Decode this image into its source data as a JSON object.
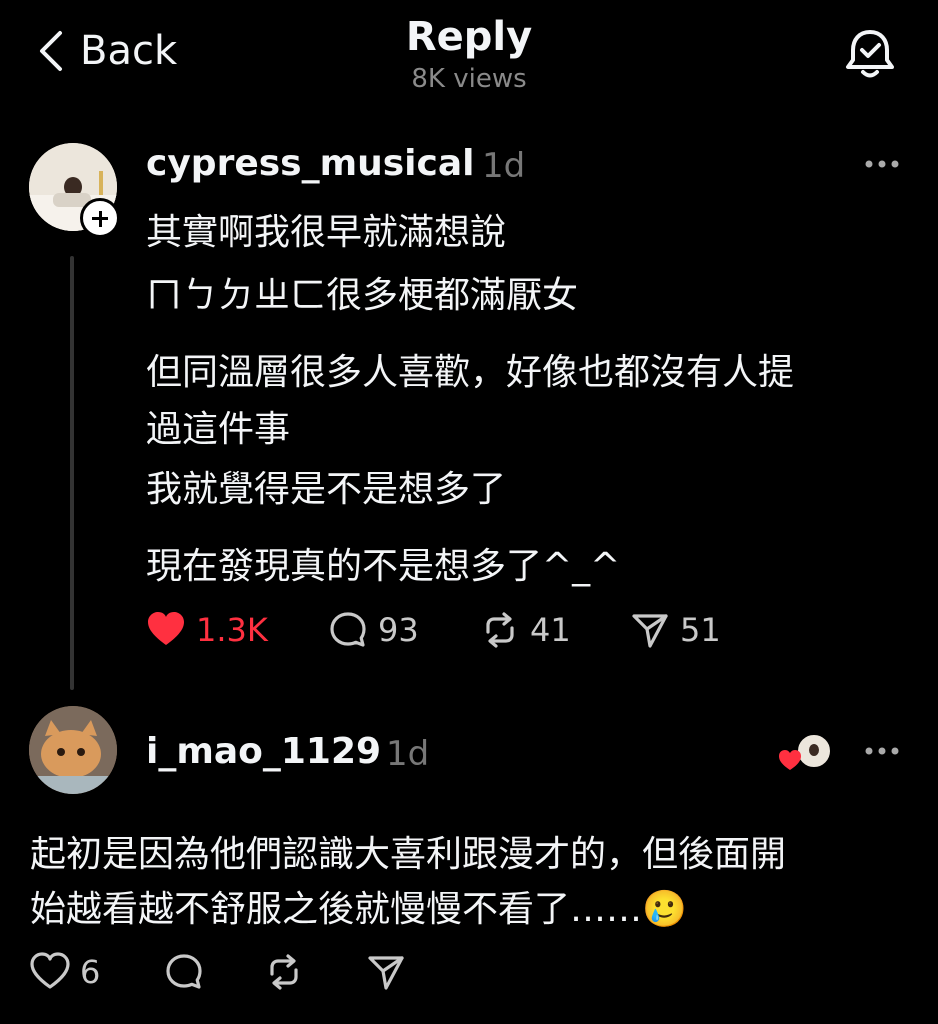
{
  "header": {
    "back_label": "Back",
    "title": "Reply",
    "views": "8K views"
  },
  "post": {
    "username": "cypress_musical",
    "time": "1d",
    "lines": [
      "其實啊我很早就滿想說",
      "ㄇㄅㄉㄓㄈ很多梗都滿厭女",
      "但同溫層很多人喜歡，好像也都沒有人提",
      "過這件事",
      "我就覺得是不是想多了",
      "現在發現真的不是想多了^_^"
    ],
    "likes": "1.3K",
    "comments": "93",
    "reposts": "41",
    "shares": "51",
    "like_color": "#ff3040"
  },
  "reply": {
    "username": "i_mao_1129",
    "time": "1d",
    "lines": [
      "起初是因為他們認識大喜利跟漫才的，但後面開",
      "始越看越不舒服之後就慢慢不看了……🥲"
    ],
    "likes": "6"
  },
  "icons": [
    "chevron-left-icon",
    "bell-icon",
    "plus-icon",
    "more-icon",
    "heart-icon",
    "comment-icon",
    "repost-icon",
    "share-icon"
  ]
}
